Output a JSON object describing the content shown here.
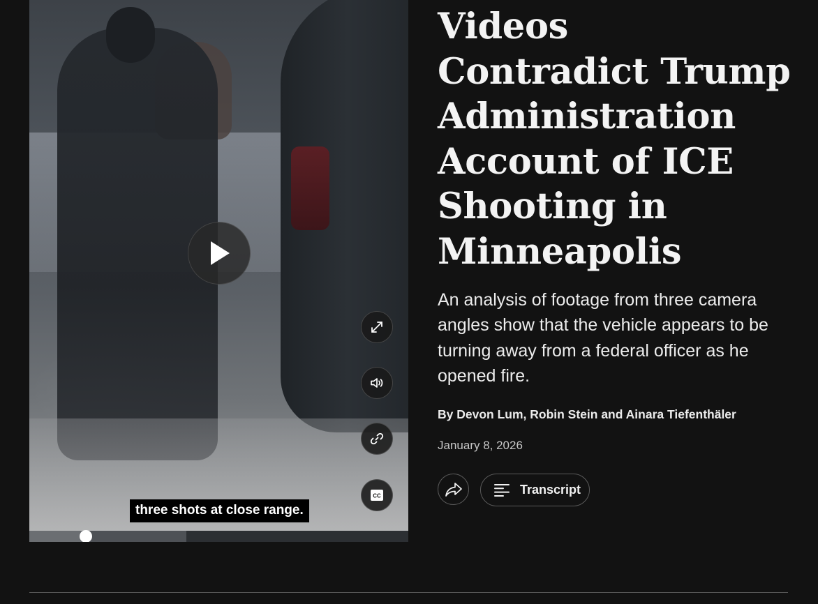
{
  "video": {
    "caption": "three shots at close range.",
    "progress_fraction": 0.15,
    "buffered_fraction": 0.415,
    "controls": {
      "fullscreen_icon": "expand-arrows-icon",
      "volume_icon": "speaker-icon",
      "link_icon": "link-icon",
      "captions_icon": "cc-icon"
    }
  },
  "article": {
    "headline_lines": [
      "Videos",
      "Contradict Trump",
      "Administration",
      "Account of ICE",
      "Shooting in",
      "Minneapolis"
    ],
    "summary": "An analysis of footage from three camera angles show that the vehicle appears to be turning away from a federal officer as he opened fire.",
    "byline": "By Devon Lum, Robin Stein and Ainara Tiefenthäler",
    "date": "January 8, 2026",
    "share_icon": "share-arrow-icon",
    "transcript_label": "Transcript",
    "transcript_icon": "text-lines-icon"
  },
  "colors": {
    "background": "#121212",
    "text": "#f3f3f3",
    "muted": "#c7c7c7",
    "border": "#5a5a5a"
  }
}
